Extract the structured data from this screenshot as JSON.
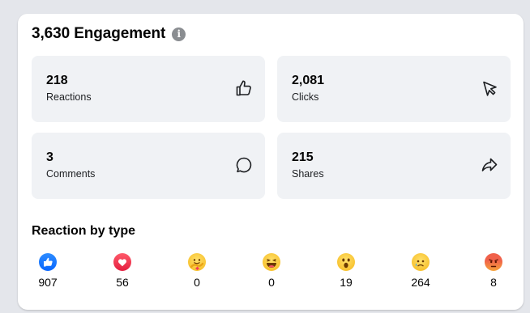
{
  "header": {
    "title": "3,630 Engagement",
    "info_icon": "info-icon"
  },
  "stats": [
    {
      "value": "218",
      "label": "Reactions",
      "icon": "thumbs-up-icon"
    },
    {
      "value": "2,081",
      "label": "Clicks",
      "icon": "cursor-icon"
    },
    {
      "value": "3",
      "label": "Comments",
      "icon": "comment-bubble-icon"
    },
    {
      "value": "215",
      "label": "Shares",
      "icon": "share-arrow-icon"
    }
  ],
  "reactions_section": {
    "title": "Reaction by type",
    "items": [
      {
        "type": "like",
        "count": "907",
        "color": "#0866ff"
      },
      {
        "type": "love",
        "count": "56",
        "color": "#e41e3f"
      },
      {
        "type": "care",
        "count": "0",
        "color": "#f7b125"
      },
      {
        "type": "haha",
        "count": "0",
        "color": "#f7b125"
      },
      {
        "type": "wow",
        "count": "19",
        "color": "#f7b125"
      },
      {
        "type": "sad",
        "count": "264",
        "color": "#f7b125"
      },
      {
        "type": "angry",
        "count": "8",
        "color": "#e9710f"
      }
    ]
  }
}
